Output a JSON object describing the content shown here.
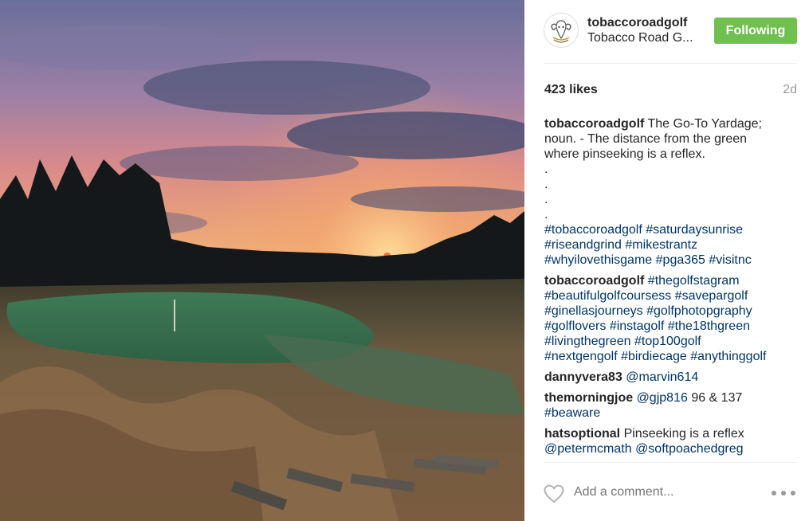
{
  "post": {
    "photo_icon": "golf-course-sunrise-photo"
  },
  "header": {
    "username": "tobaccoroadgolf",
    "subtitle": "Tobacco Road G...",
    "follow_label": "Following",
    "follow_color": "#70c050",
    "avatar_icon": "ram-skull-logo"
  },
  "meta": {
    "likes": "423 likes",
    "age": "2d"
  },
  "caption": {
    "user": "tobaccoroadgolf",
    "text_line1": "The Go-To Yardage;",
    "text_line2": "noun. - The distance from the green",
    "text_line3": "where pinseeking is a reflex.",
    "dots": [
      ".",
      ".",
      ".",
      "."
    ],
    "tags_line1": [
      "#tobaccoroadgolf",
      "#saturdaysunrise"
    ],
    "tags_line2": [
      "#riseandgrind",
      "#mikestrantz"
    ],
    "tags_line3": [
      "#whyilovethisgame",
      "#pga365",
      "#visitnc"
    ]
  },
  "comments": [
    {
      "user": "tobaccoroadgolf",
      "line1_tag": "#thegolfstagram",
      "line2": [
        "#beautifulgolfcoursess",
        "#savepargolf"
      ],
      "line3": [
        "#ginellasjourneys",
        "#golfphotopgraphy"
      ],
      "line4": [
        "#golflovers",
        "#instagolf",
        "#the18thgreen"
      ],
      "line5": [
        "#livingthegreen",
        "#top100golf"
      ],
      "line6": [
        "#nextgengolf",
        "#birdiecage",
        "#anythinggolf"
      ]
    },
    {
      "user": "dannyvera83",
      "mention": "@marvin614"
    },
    {
      "user": "themorningjoe",
      "mention": "@gjp816",
      "text": "96 & 137",
      "tag": "#beaware"
    },
    {
      "user": "hatsoptional",
      "text": "Pinseeking is a reflex",
      "mentions": [
        "@petermcmath",
        "@softpoachedgreg"
      ]
    }
  ],
  "footer": {
    "placeholder": "Add a comment...",
    "heart_icon": "heart-outline-icon",
    "more_icon": "more-options-icon"
  },
  "colors": {
    "hashtag": "#003569",
    "muted": "#999999",
    "text": "#262626"
  }
}
